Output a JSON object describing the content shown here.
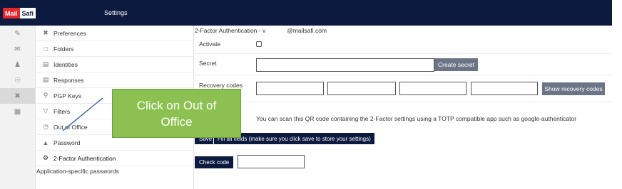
{
  "topbar": {
    "logo_part1": "Mail",
    "logo_part2": "Safi",
    "title": "Settings"
  },
  "iconrail": {
    "items": [
      "compose-icon",
      "inbox-icon",
      "contacts-icon",
      "globe-icon",
      "tools-icon",
      "apps-icon"
    ],
    "active_index": 4
  },
  "menu": {
    "items": [
      {
        "label": "Preferences",
        "icon": "tools-icon"
      },
      {
        "label": "Folders",
        "icon": "folder-icon"
      },
      {
        "label": "Identities",
        "icon": "id-card-icon"
      },
      {
        "label": "Responses",
        "icon": "message-icon"
      },
      {
        "label": "PGP Keys",
        "icon": "key-icon"
      },
      {
        "label": "Filters",
        "icon": "filter-icon"
      },
      {
        "label": "Out of Office",
        "icon": "clock-icon"
      },
      {
        "label": "Password",
        "icon": "lock-icon"
      },
      {
        "label": "2-Factor Authentication",
        "icon": "gear-icon"
      }
    ],
    "selected_index": 8,
    "sub_item": "Application-specific passwords"
  },
  "content": {
    "header_prefix": "2-Factor Authentication - v",
    "header_suffix": "@mailsafi.com",
    "activate_label": "Activate",
    "activate_checked": false,
    "secret_label": "Secret",
    "secret_value": "",
    "create_secret_label": "Create secret",
    "recovery_label": "Recovery codes",
    "recovery_codes": [
      "",
      "",
      "",
      ""
    ],
    "show_recovery_label": "Show recovery codes",
    "qr_info": "You can scan this QR code containing the 2-Factor settings using a TOTP compatible app such as google-authenticator",
    "save_label": "Save",
    "save_tooltip": "Fill all fields (make sure you click save to store your settings)",
    "check_code_label": "Check code",
    "check_code_value": ""
  },
  "callout": {
    "line1": "Click on Out of",
    "line2": "Office",
    "color": "#8cc152"
  },
  "colors": {
    "navy": "#0c1a3f",
    "brand_red": "#e8262a",
    "button_gray": "#6b7585"
  }
}
